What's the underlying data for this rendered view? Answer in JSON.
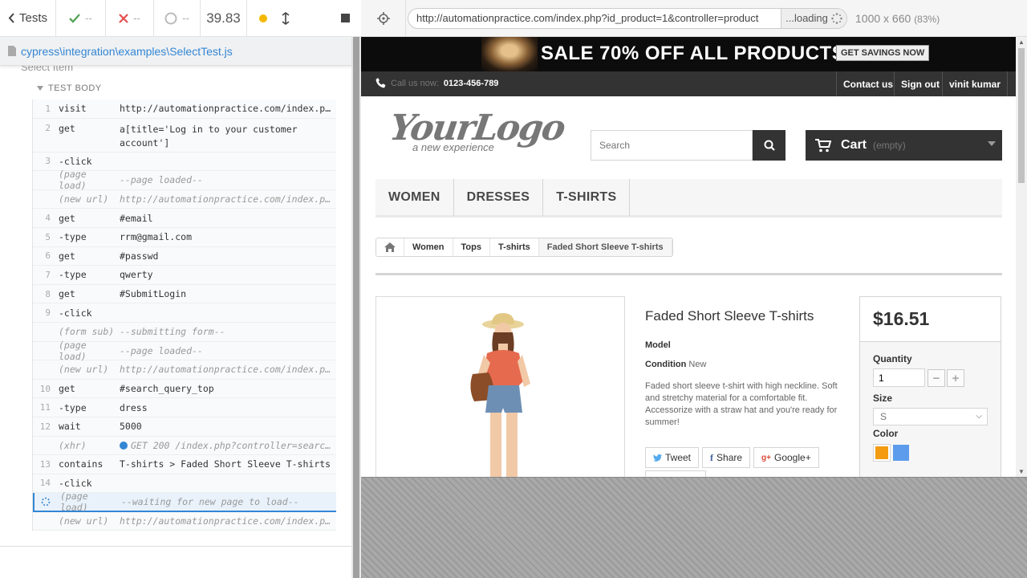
{
  "reporter": {
    "back_label": "Tests",
    "passed": "--",
    "failed": "--",
    "pending": "--",
    "duration": "39.83",
    "spec_path": "cypress\\integration\\examples\\SelectTest.js",
    "suite_title": "Select Item",
    "test_body_label": "TEST BODY",
    "commands": [
      {
        "num": "1",
        "name": "visit",
        "msg": "http://automationpractice.com/index.php?controller=authentication",
        "kind": "cmd"
      },
      {
        "num": "2",
        "name": "get",
        "msg": "a[title='Log in to your customer account']",
        "kind": "tall"
      },
      {
        "num": "3",
        "name": " -click",
        "msg": "",
        "kind": "cmd"
      },
      {
        "num": "",
        "name": "(page load)",
        "msg": "--page loaded--",
        "kind": "event"
      },
      {
        "num": "",
        "name": "(new url)",
        "msg": "http://automationpractice.com/index.php?controller=authentication",
        "kind": "event"
      },
      {
        "num": "4",
        "name": "get",
        "msg": "#email",
        "kind": "cmd"
      },
      {
        "num": "5",
        "name": " -type",
        "msg": "rrm@gmail.com",
        "kind": "cmd"
      },
      {
        "num": "6",
        "name": "get",
        "msg": "#passwd",
        "kind": "cmd"
      },
      {
        "num": "7",
        "name": " -type",
        "msg": "qwerty",
        "kind": "cmd"
      },
      {
        "num": "8",
        "name": "get",
        "msg": "#SubmitLogin",
        "kind": "cmd"
      },
      {
        "num": "9",
        "name": " -click",
        "msg": "",
        "kind": "cmd"
      },
      {
        "num": "",
        "name": "(form sub)",
        "msg": "--submitting form--",
        "kind": "event"
      },
      {
        "num": "",
        "name": "(page load)",
        "msg": "--page loaded--",
        "kind": "event"
      },
      {
        "num": "",
        "name": "(new url)",
        "msg": "http://automationpractice.com/index.php?controller=my-account",
        "kind": "event"
      },
      {
        "num": "10",
        "name": "get",
        "msg": "#search_query_top",
        "kind": "cmd"
      },
      {
        "num": "11",
        "name": " -type",
        "msg": "dress",
        "kind": "cmd"
      },
      {
        "num": "12",
        "name": "wait",
        "msg": "5000",
        "kind": "cmd"
      },
      {
        "num": "",
        "name": "(xhr)",
        "msg": "GET 200 /index.php?controller=search&q=dress",
        "kind": "xhr"
      },
      {
        "num": "13",
        "name": "contains",
        "msg": "T-shirts > Faded Short Sleeve T-shirts",
        "kind": "cmd"
      },
      {
        "num": "14",
        "name": " -click",
        "msg": "",
        "kind": "cmd"
      },
      {
        "num": "",
        "name": "(page load)",
        "msg": "--waiting for new page to load--",
        "kind": "active"
      },
      {
        "num": "",
        "name": "(new url)",
        "msg": "http://automationpractice.com/index.php?id_product=1&controller=product",
        "kind": "event"
      }
    ]
  },
  "aut_header": {
    "url": "http://automationpractice.com/index.php?id_product=1&controller=product",
    "loading_label": "...loading",
    "viewport": "1000 x 660",
    "scale": "(83%)"
  },
  "site": {
    "banner_text": "SALE 70% OFF ALL PRODUCTS",
    "banner_button": "GET SAVINGS NOW",
    "call_label": "Call us now:",
    "phone": "0123-456-789",
    "nav_links": [
      "Contact us",
      "Sign out",
      "vinit kumar"
    ],
    "logo_big": "YourLogo",
    "logo_small": "a new experience",
    "search_placeholder": "Search",
    "cart_label": "Cart",
    "cart_status": "(empty)",
    "menu": [
      "WOMEN",
      "DRESSES",
      "T-SHIRTS"
    ],
    "breadcrumbs": [
      "Women",
      "Tops",
      "T-shirts",
      "Faded Short Sleeve T-shirts"
    ],
    "product": {
      "title": "Faded Short Sleeve T-shirts",
      "model_label": "Model",
      "condition_label": "Condition",
      "condition_value": "New",
      "description": "Faded short sleeve t-shirt with high neckline. Soft and stretchy material for a comfortable fit. Accessorize with a straw hat and you're ready for summer!",
      "social": [
        "Tweet",
        "Share",
        "Google+"
      ],
      "price": "$16.51",
      "quantity_label": "Quantity",
      "quantity": "1",
      "size_label": "Size",
      "size_value": "S",
      "color_label": "Color",
      "colors": [
        "#f39c11",
        "#5d9cec"
      ]
    }
  }
}
